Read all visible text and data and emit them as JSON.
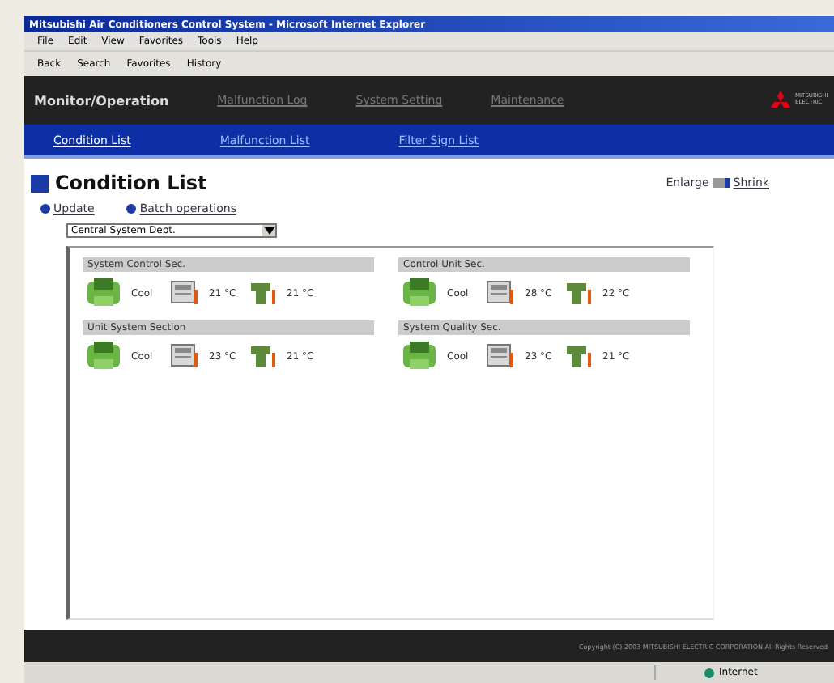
{
  "window": {
    "title": "Mitsubishi Air Conditioners Control System - Microsoft Internet Explorer"
  },
  "menu": [
    "File",
    "Edit",
    "View",
    "Favorites",
    "Tools",
    "Help"
  ],
  "toolbar": [
    "Back",
    "Search",
    "Favorites",
    "History"
  ],
  "nav": [
    {
      "label": "Monitor/Operation",
      "selected": true
    },
    {
      "label": "Malfunction Log",
      "selected": false
    },
    {
      "label": "System Setting",
      "selected": false
    },
    {
      "label": "Maintenance",
      "selected": false
    }
  ],
  "logo": "MITSUBISHI ELECTRIC",
  "subnav": [
    {
      "label": "Condition List",
      "selected": true
    },
    {
      "label": "Malfunction List",
      "selected": false
    },
    {
      "label": "Filter Sign List",
      "selected": false
    }
  ],
  "page_title": "Condition List",
  "links": [
    "Update",
    "Batch operations"
  ],
  "size_links": [
    "Enlarge",
    "Shrink"
  ],
  "block_select": {
    "value": "Central System Dept."
  },
  "groups": [
    {
      "name": "System Control Sec.",
      "mode": "Cool",
      "set_temp": "21 °C",
      "room_temp": "21 °C"
    },
    {
      "name": "Control Unit Sec.",
      "mode": "Cool",
      "set_temp": "28 °C",
      "room_temp": "22 °C"
    },
    {
      "name": "Unit System Section",
      "mode": "Cool",
      "set_temp": "23 °C",
      "room_temp": "21 °C"
    },
    {
      "name": "System Quality Sec.",
      "mode": "Cool",
      "set_temp": "23 °C",
      "room_temp": "21 °C"
    }
  ],
  "footer": "Copyright (C) 2003 MITSUBISHI ELECTRIC CORPORATION All Rights Reserved",
  "status_bar": {
    "zone": "Internet"
  }
}
